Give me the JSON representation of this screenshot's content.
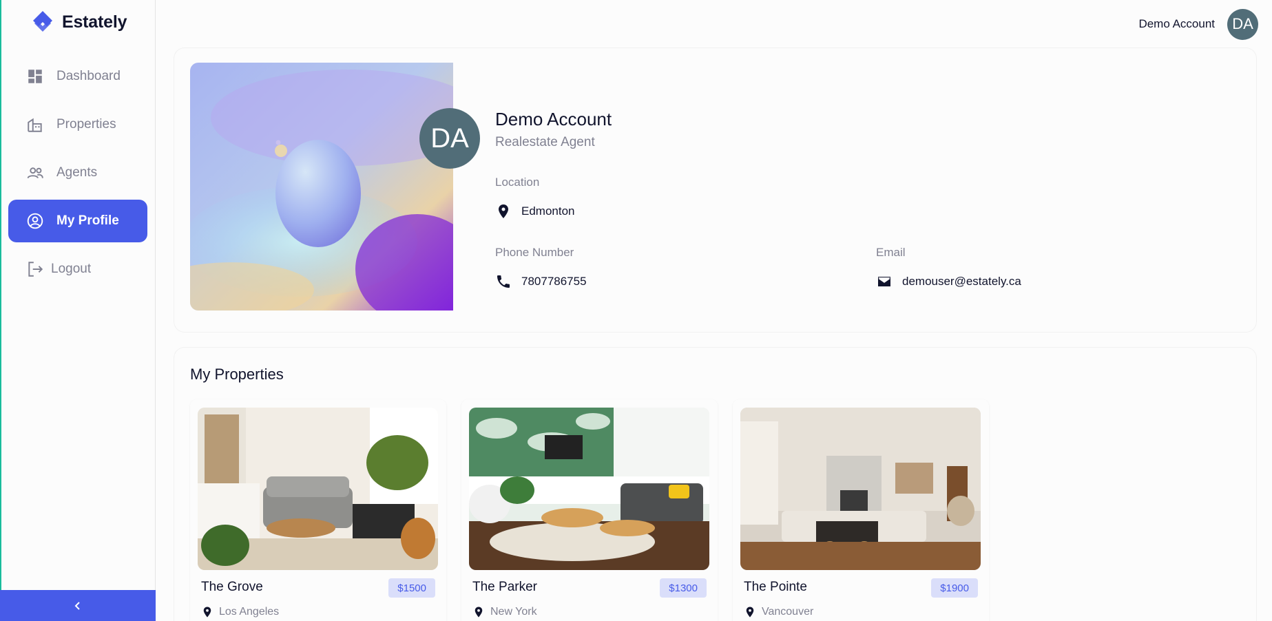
{
  "brand": {
    "name": "Estately",
    "accent": "#475be8"
  },
  "nav": {
    "items": [
      {
        "label": "Dashboard",
        "icon": "dashboard-icon"
      },
      {
        "label": "Properties",
        "icon": "properties-icon"
      },
      {
        "label": "Agents",
        "icon": "agents-icon"
      },
      {
        "label": "My Profile",
        "icon": "profile-icon",
        "active": true
      },
      {
        "label": "Logout",
        "icon": "logout-icon"
      }
    ],
    "collapse_icon": "chevron-left-icon"
  },
  "header": {
    "user_name": "Demo Account",
    "avatar_initials": "DA"
  },
  "profile": {
    "avatar_initials": "DA",
    "name": "Demo Account",
    "role": "Realestate Agent",
    "location_label": "Location",
    "location": "Edmonton",
    "phone_label": "Phone Number",
    "phone": "7807786755",
    "email_label": "Email",
    "email": "demouser@estately.ca"
  },
  "my_properties": {
    "title": "My Properties",
    "items": [
      {
        "name": "The Grove",
        "price": "$1500",
        "location": "Los Angeles"
      },
      {
        "name": "The Parker",
        "price": "$1300",
        "location": "New York"
      },
      {
        "name": "The Pointe",
        "price": "$1900",
        "location": "Vancouver"
      }
    ]
  }
}
